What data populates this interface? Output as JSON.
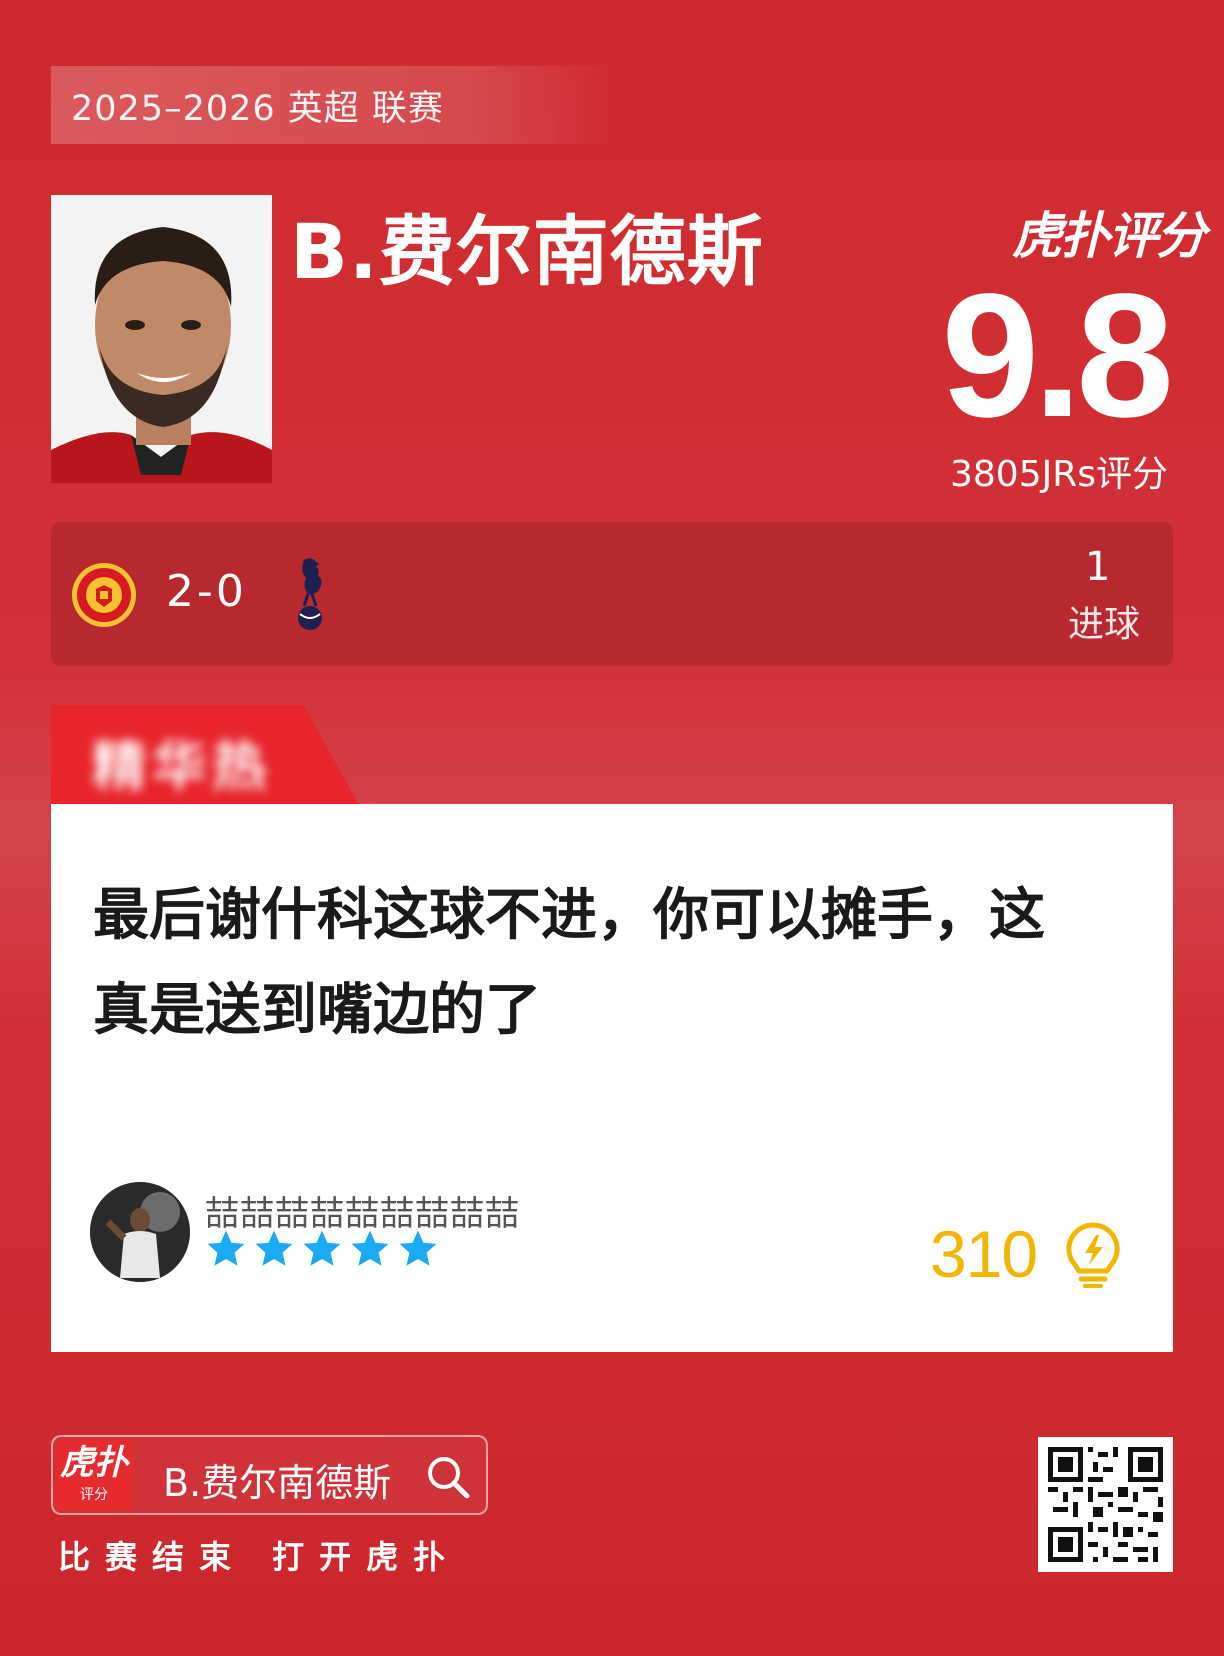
{
  "season": "2025–2026 英超 联赛",
  "player": {
    "name": "B.费尔南德斯"
  },
  "rating": {
    "brand": "虎扑评分",
    "score": "9.8",
    "votes": "3805JRs评分"
  },
  "match": {
    "home_team_icon": "manchester-united-crest-icon",
    "away_team_icon": "tottenham-cockerel-icon",
    "score": "2-0",
    "stat_value": "1",
    "stat_label": "进球"
  },
  "comment": {
    "tag": "精华热",
    "text": "最后谢什科这球不进，你可以摊手，这真是送到嘴边的了",
    "username": "喆喆喆喆喆喆喆喆喆",
    "stars": 5,
    "likes": "310",
    "colors": {
      "star": "#1aa9f2",
      "likes": "#f0b600"
    }
  },
  "footer": {
    "app_icon_main": "虎扑",
    "app_icon_sub": "评分",
    "search_text": "B.费尔南德斯",
    "cta": "比赛结束 打开虎扑"
  },
  "colors": {
    "background": "#cf2a2e",
    "tag": "#e8252c"
  }
}
